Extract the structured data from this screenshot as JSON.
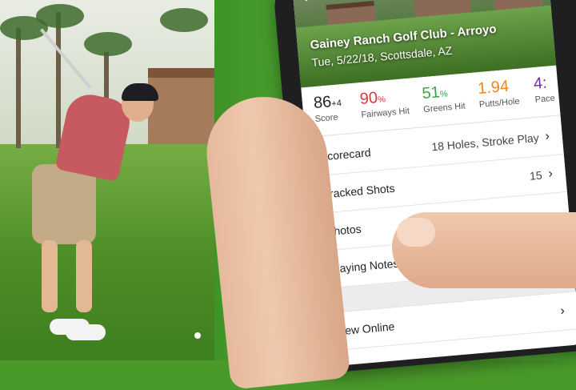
{
  "course": {
    "name": "Gainey Ranch Golf Club - Arroyo",
    "date_location": "Tue, 5/22/18, Scottsdale, AZ"
  },
  "stats": [
    {
      "value": "86",
      "suffix": "+4",
      "label": "Score",
      "color": "#222222"
    },
    {
      "value": "90",
      "suffix": "%",
      "label": "Fairways Hit",
      "color": "#d8363a"
    },
    {
      "value": "51",
      "suffix": "%",
      "label": "Greens Hit",
      "color": "#3aa64a"
    },
    {
      "value": "1.94",
      "suffix": "",
      "label": "Putts/Hole",
      "color": "#f0841c"
    },
    {
      "value": "4:",
      "suffix": "",
      "label": "Pace",
      "color": "#7a2aa0"
    }
  ],
  "menu": {
    "scorecard": {
      "label": "Scorecard",
      "detail": "18 Holes, Stroke Play"
    },
    "tracked_shots": {
      "label": "Tracked Shots",
      "detail": "15"
    },
    "photos": {
      "label": "Photos"
    },
    "playing_notes": {
      "label": "Playing Notes"
    },
    "view_online": {
      "label": "View Online"
    }
  },
  "icons": {
    "back": "chevron-left-icon",
    "row_chevron": "chevron-right-icon"
  }
}
